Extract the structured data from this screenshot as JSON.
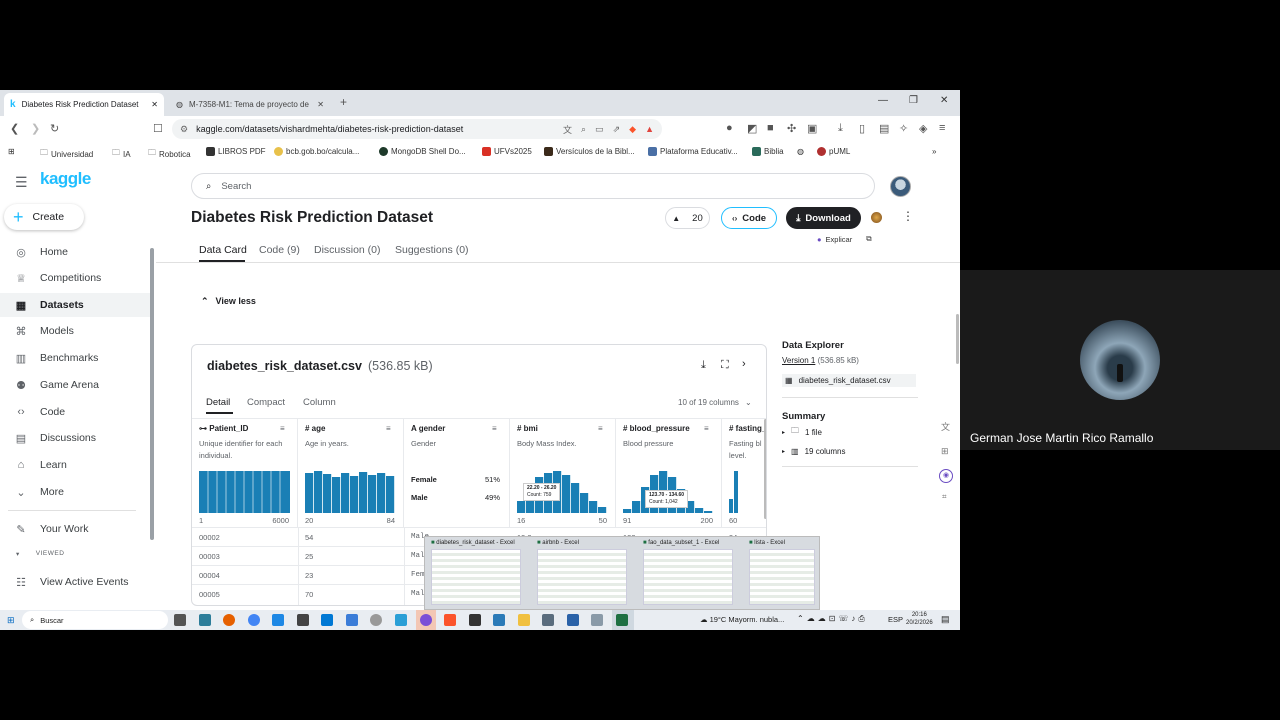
{
  "tabs": [
    {
      "title": "Diabetes Risk Prediction Dataset",
      "icon": "kaggle-k"
    },
    {
      "title": "M-7358-M1: Tema de proyecto de m"
    }
  ],
  "address_bar": {
    "url": "kaggle.com/datasets/vishardmehta/diabetes-risk-prediction-dataset"
  },
  "bookmarks": [
    "Universidad",
    "IA",
    "Robotica",
    "LIBROS PDF",
    "bcb.gob.bo/calcula...",
    "MongoDB Shell Do...",
    "UFVs2025",
    "Versículos de la Bibl...",
    "Plataforma Educativ...",
    "Biblia",
    "pUML"
  ],
  "sidebar": {
    "logo": "kaggle",
    "create_label": "Create",
    "items": [
      {
        "label": "Home",
        "icon": "compass-icon"
      },
      {
        "label": "Competitions",
        "icon": "trophy-icon"
      },
      {
        "label": "Datasets",
        "icon": "table-icon",
        "active": true
      },
      {
        "label": "Models",
        "icon": "models-icon"
      },
      {
        "label": "Benchmarks",
        "icon": "chart-icon"
      },
      {
        "label": "Game Arena",
        "icon": "game-icon"
      },
      {
        "label": "Code",
        "icon": "code-icon"
      },
      {
        "label": "Discussions",
        "icon": "discussion-icon"
      },
      {
        "label": "Learn",
        "icon": "learn-icon"
      },
      {
        "label": "More",
        "icon": "chevron-down-icon"
      }
    ],
    "your_work": "Your Work",
    "viewed_label": "VIEWED",
    "view_active_events": "View Active Events"
  },
  "search": {
    "placeholder": "Search"
  },
  "dataset": {
    "title": "Diabetes Risk Prediction Dataset",
    "upvotes": "20",
    "code_button": "Code",
    "download_button": "Download",
    "explain_label": "Explicar",
    "tabs": [
      "Data Card",
      "Code (9)",
      "Discussion (0)",
      "Suggestions (0)"
    ],
    "view_less": "View less"
  },
  "csv_card": {
    "filename": "diabetes_risk_dataset.csv",
    "size": "(536.85 kB)",
    "subtabs": [
      "Detail",
      "Compact",
      "Column"
    ],
    "columns_count": "10 of 19 columns",
    "columns": [
      {
        "name": "Patient_ID",
        "desc": "Unique identifier for each individual.",
        "min": "1",
        "max": "6000"
      },
      {
        "name": "age",
        "desc": "Age in years.",
        "min": "20",
        "max": "84"
      },
      {
        "name": "gender",
        "desc": "Gender",
        "female_label": "Female",
        "female_pct": "51%",
        "male_label": "Male",
        "male_pct": "49%"
      },
      {
        "name": "bmi",
        "desc": "Body Mass Index.",
        "min": "16",
        "max": "50",
        "tooltip_range": "22.20 - 26.20",
        "tooltip_count": "Count: 759"
      },
      {
        "name": "blood_pressure",
        "desc": "Blood pressure",
        "min": "91",
        "max": "200",
        "tooltip_range": "123.70 - 134.60",
        "tooltip_count": "Count: 1,042"
      },
      {
        "name": "fasting_",
        "desc": "Fasting bl level.",
        "min": "60",
        "max": ""
      }
    ],
    "rows": [
      [
        "00002",
        "54",
        "Male",
        "19.2",
        "123",
        "94"
      ],
      [
        "00003",
        "25",
        "Male",
        "",
        "",
        ""
      ],
      [
        "00004",
        "23",
        "Fem",
        "",
        "",
        ""
      ],
      [
        "00005",
        "70",
        "Mal",
        "",
        "",
        ""
      ]
    ]
  },
  "explorer": {
    "title": "Data Explorer",
    "version": "Version 1",
    "version_size": "(536.85 kB)",
    "file": "diabetes_risk_dataset.csv",
    "summary_title": "Summary",
    "summary_items": [
      "1 file",
      "19 columns"
    ]
  },
  "thumbnails": [
    "diabetes_risk_dataset - Excel",
    "airbnb - Excel",
    "fao_data_subset_1 - Excel",
    "lista - Excel"
  ],
  "taskbar": {
    "search_label": "Buscar",
    "weather": "19°C  Mayorm. nubla...",
    "lang": "ESP",
    "time": "20:16",
    "date": "20/2/2026"
  },
  "participant": {
    "name": "German Jose Martin Rico Ramallo"
  },
  "colors": {
    "kaggle_blue": "#20beff",
    "bar_blue": "#1a7fb5",
    "dark_button": "#202124"
  }
}
